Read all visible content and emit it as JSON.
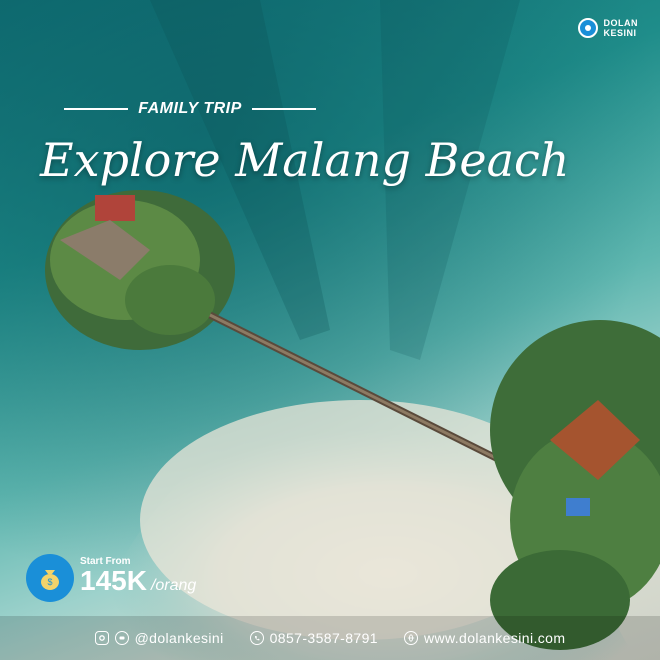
{
  "brand": {
    "line1": "DOLAN",
    "line2": "KESINI"
  },
  "trip_label": "FAMILY TRIP",
  "headline": "Explore Malang Beach",
  "price": {
    "from": "Start From",
    "amount": "145K",
    "per": "/orang"
  },
  "footer": {
    "social": "@dolankesini",
    "phone": "0857-3587-8791",
    "website": "www.dolankesini.com"
  },
  "icons": [
    "logo-icon",
    "money-bag-icon",
    "instagram-icon",
    "line-icon",
    "whatsapp-icon",
    "globe-icon"
  ]
}
